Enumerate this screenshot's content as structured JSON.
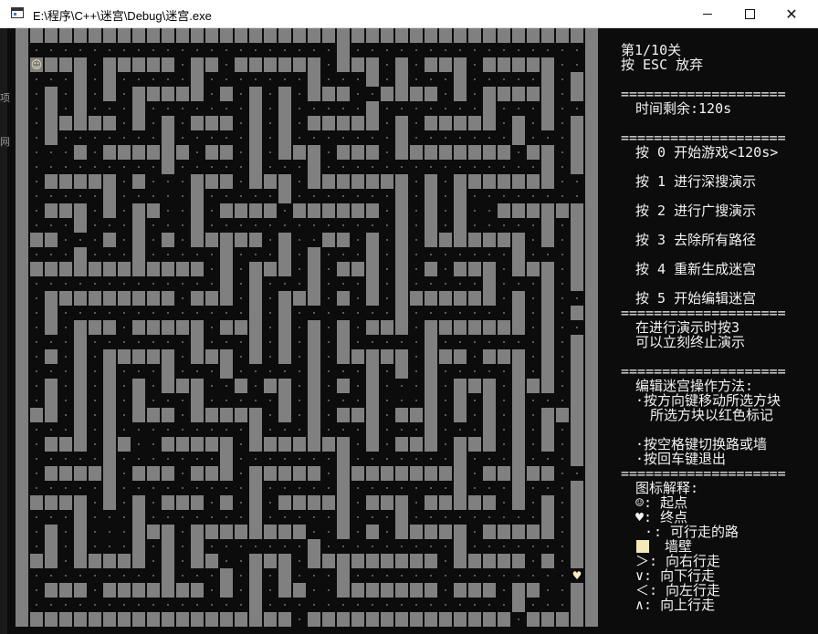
{
  "window": {
    "title": "E:\\程序\\C++\\迷宫\\Debug\\迷宫.exe",
    "minimize_icon": "window-minimize",
    "maximize_icon": "window-maximize",
    "close_icon": "window-close",
    "close_glyph": "✕"
  },
  "background_edge": [
    "项",
    "网"
  ],
  "maze": {
    "cols": 38,
    "rows": 40,
    "start_symbol": "☺",
    "end_symbol": "♥",
    "start_cell": [
      1,
      2
    ],
    "end_cell": [
      38,
      37
    ],
    "colors": {
      "wall": "#808080",
      "floor": "#0c0c0c",
      "dot": "#5a5a5a",
      "start": "#f0e6b0",
      "end": "#f8eec0"
    }
  },
  "info": {
    "level": "第1/10关",
    "quit_hint": "按 ESC 放弃",
    "separator": "====================",
    "time_remaining": "时间剩余:120s",
    "menu": [
      "按 0 开始游戏<120s>",
      "按 1 进行深搜演示",
      "按 2 进行广搜演示",
      "按 3 去除所有路径",
      "按 4 重新生成迷宫",
      "按 5 开始编辑迷宫"
    ],
    "demo_note": [
      "在进行演示时按3",
      "可以立刻终止演示"
    ],
    "edit_title": "编辑迷宫操作方法:",
    "edit_lines": [
      "·按方向键移动所选方块",
      "所选方块以红色标记",
      "·按空格键切换路或墙",
      "·按回车键退出"
    ],
    "legend_title": "图标解释:",
    "legend": {
      "start": "☺: 起点",
      "end": "♥: 终点",
      "road_symbol": "·",
      "road": ": 可行走的路",
      "wall": "墙壁",
      "right": "＞: 向右行走",
      "down": "∨: 向下行走",
      "left": "＜: 向左行走",
      "up": "∧: 向上行走"
    }
  }
}
